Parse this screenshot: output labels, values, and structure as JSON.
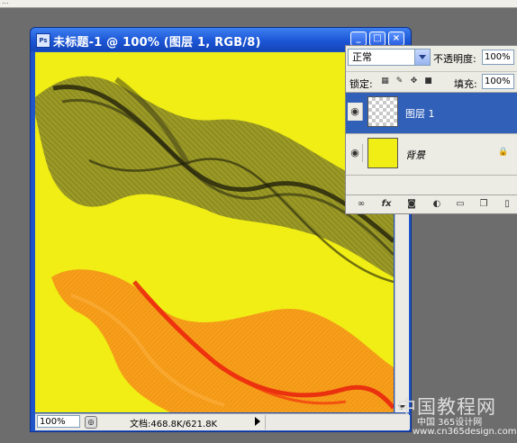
{
  "document": {
    "app_icon": "Ps",
    "title": "未标题-1 @ 100% (图层 1, RGB/8)",
    "zoom": "100%",
    "doc_info": "文档:468.8K/621.8K",
    "canvas_color": "#f0ee14"
  },
  "layers_panel": {
    "blend_mode": "正常",
    "opacity_label": "不透明度:",
    "opacity_value": "100%",
    "lock_label": "锁定:",
    "fill_label": "填充:",
    "fill_value": "100%",
    "layers": [
      {
        "name": "图层 1",
        "selected": true,
        "thumb": "transparent",
        "locked": false
      },
      {
        "name": "背景",
        "selected": false,
        "thumb": "yellow",
        "locked": true
      }
    ],
    "bottom_icons": [
      "link-icon",
      "fx-icon",
      "mask-icon",
      "adjustment-icon",
      "group-folder-icon",
      "new-layer-icon",
      "trash-icon"
    ]
  },
  "watermark": {
    "line1": "中国教程网",
    "line2": "中国 365设计网",
    "line3": "www.cn365design.com"
  },
  "colors": {
    "title_bar": "#1f55c8",
    "selected_layer": "#3060b8",
    "ribbon_dark": "#1a1a0a",
    "ribbon_orange": "#f59a1a",
    "ribbon_red": "#e81e0e"
  }
}
